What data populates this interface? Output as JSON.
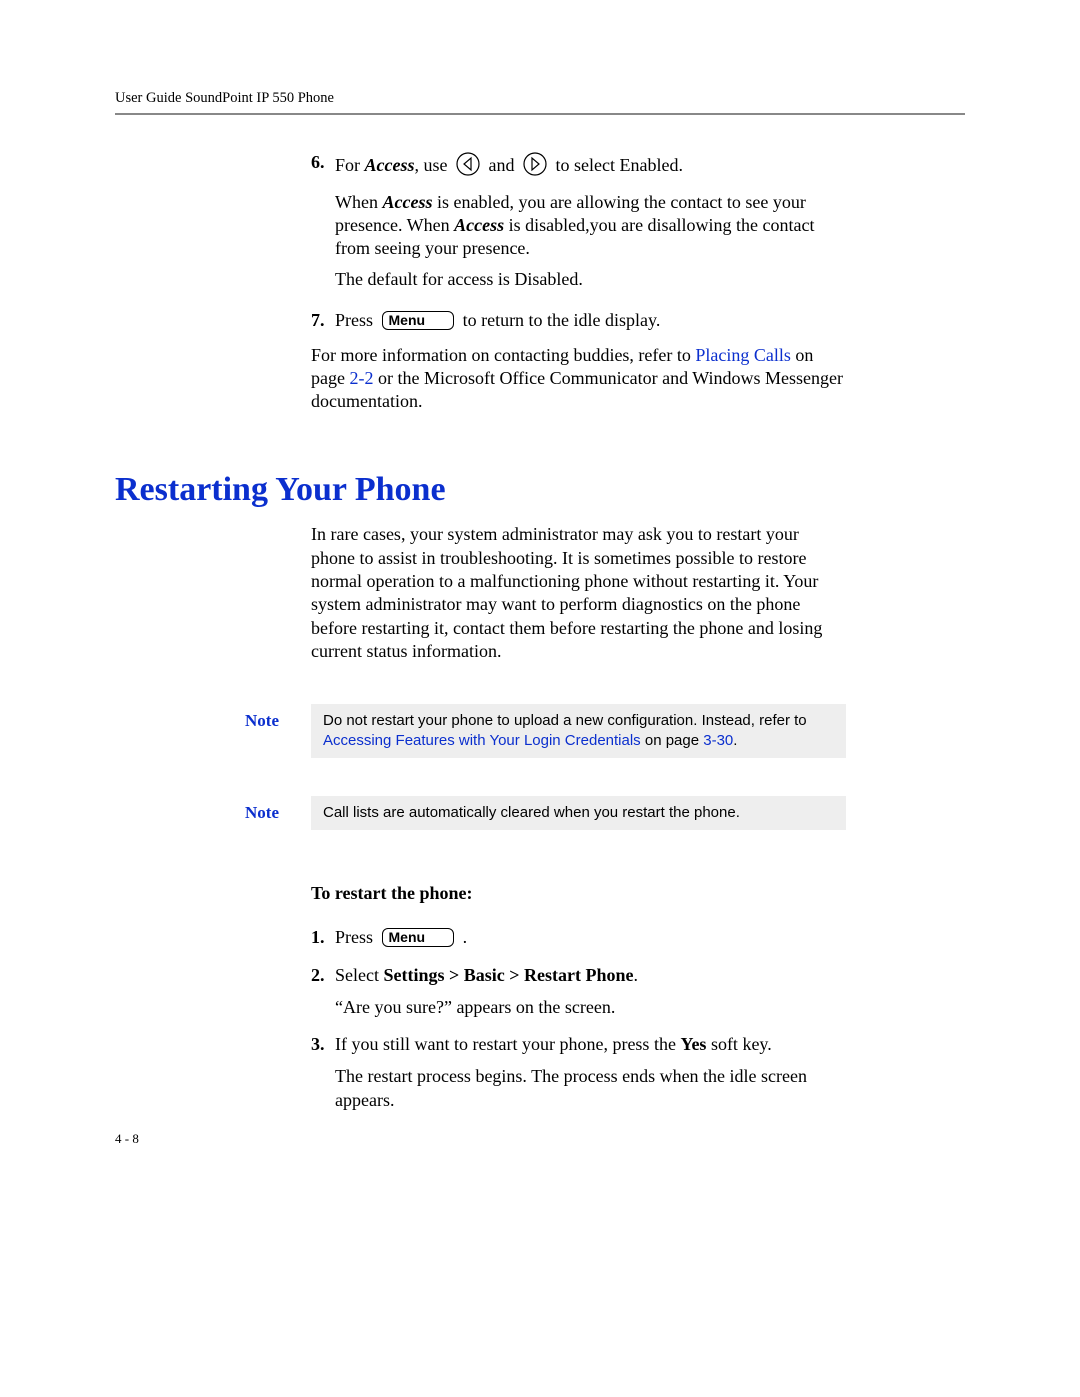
{
  "header": {
    "running_head": "User Guide SoundPoint IP 550 Phone"
  },
  "step6": {
    "num": "6.",
    "line1_pre": "For ",
    "line1_access": "Access",
    "line1_mid1": ", use ",
    "line1_mid2": " and ",
    "line1_post": " to select Enabled.",
    "sub_a_pre": "When ",
    "sub_a_access": "Access",
    "sub_a_post": " is enabled, you are allowing the contact to see your presence. When ",
    "sub_a_access2": "Access",
    "sub_a_tail": " is disabled,you are disallowing the contact from seeing your presence.",
    "sub_b": "The default for access is Disabled."
  },
  "step7": {
    "num": "7.",
    "pre": "Press ",
    "menu_label": "Menu",
    "post": " to return to the idle display."
  },
  "after_list": {
    "pre": "For more information on contacting buddies, refer to ",
    "link": "Placing Calls",
    "mid": " on page ",
    "pageref": "2-2",
    "tail": " or the Microsoft Office Communicator and Windows Messenger documentation."
  },
  "section": {
    "heading": "Restarting Your Phone",
    "intro": "In rare cases, your system administrator may ask you to restart your phone to assist in troubleshooting. It is sometimes possible to restore normal operation to a malfunctioning phone without restarting it. Your system administrator may want to perform diagnostics on the phone before restarting it, contact them before restarting the phone and losing current status information."
  },
  "notes": {
    "label": "Note",
    "note1_pre": "Do not restart your phone to upload a new configuration. Instead, refer to ",
    "note1_link": "Accessing Features with Your Login Credentials",
    "note1_mid": " on page ",
    "note1_pageref": "3-30",
    "note1_tail": ".",
    "note2": "Call lists are automatically cleared when you restart the phone."
  },
  "restart": {
    "task_title": "To restart the phone:",
    "s1_num": "1.",
    "s1_pre": "Press ",
    "s1_menu": "Menu",
    "s1_post": " .",
    "s2_num": "2.",
    "s2_pre": "Select ",
    "s2_bold": "Settings > Basic > Restart Phone",
    "s2_post": ".",
    "s2_sub": "“Are you sure?” appears on the screen.",
    "s3_num": "3.",
    "s3_pre": "If you still want to restart your phone, press the ",
    "s3_bold": "Yes",
    "s3_post": " soft key.",
    "s3_sub": "The restart process begins. The process ends when the idle screen appears."
  },
  "footer": {
    "pagenum": "4 - 8"
  }
}
